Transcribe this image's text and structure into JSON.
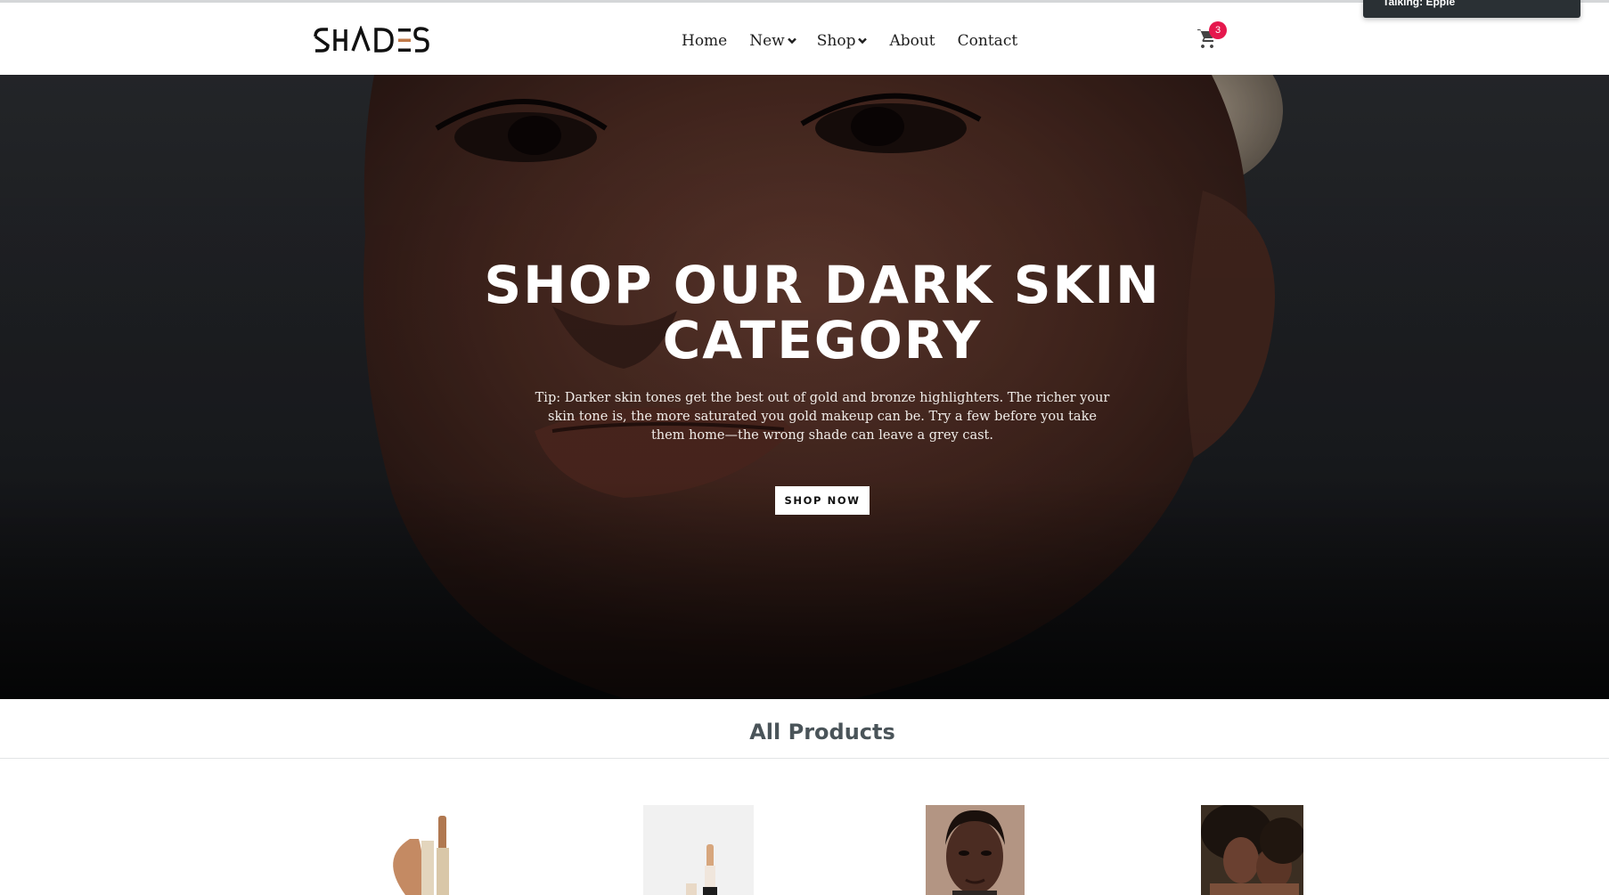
{
  "brand": {
    "logo_text": "SHADES"
  },
  "nav": {
    "items": [
      {
        "label": "Home"
      },
      {
        "label": "New"
      },
      {
        "label": "Shop"
      },
      {
        "label": "About"
      },
      {
        "label": "Contact"
      }
    ],
    "cart_count": "3"
  },
  "toast": {
    "text": "Talking: Epple"
  },
  "hero": {
    "title": "SHOP OUR DARK SKIN CATEGORY",
    "tip": "Tip: Darker skin tones get the best out of gold and bronze highlighters. The richer your skin tone is, the more saturated you gold makeup can be. Try a few before you take them home—the wrong shade can leave a grey cast.",
    "button_label": "SHOP NOW"
  },
  "products": {
    "section_title": "All Products"
  },
  "colors": {
    "accent_badge": "#e5184d",
    "logo_accent": "#c07a4a",
    "section_title": "#4a5459"
  }
}
